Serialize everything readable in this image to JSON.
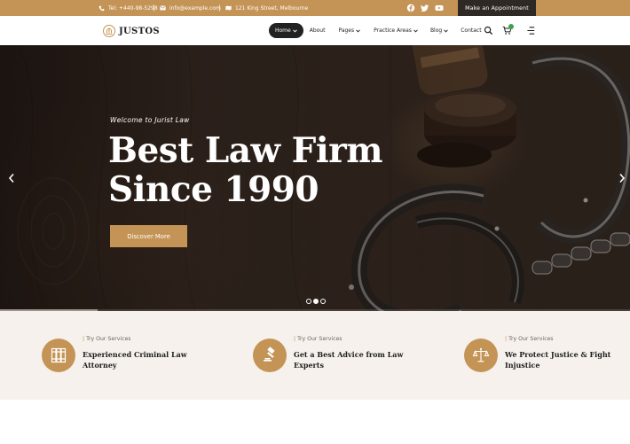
{
  "topbar": {
    "phone": "Tel: +440-98-5298",
    "email": "info@example.com",
    "address": "121 King Street, Melbourne",
    "social": [
      "facebook-icon",
      "twitter-icon",
      "youtube-icon"
    ],
    "cta_label": "Make an Appointment"
  },
  "header": {
    "logo_text": "JUSTOS",
    "nav": [
      {
        "label": "Home",
        "dropdown": true,
        "active": true
      },
      {
        "label": "About",
        "dropdown": false,
        "active": false
      },
      {
        "label": "Pages",
        "dropdown": true,
        "active": false
      },
      {
        "label": "Practice Areas",
        "dropdown": true,
        "active": false
      },
      {
        "label": "Blog",
        "dropdown": true,
        "active": false
      },
      {
        "label": "Contact",
        "dropdown": false,
        "active": false
      }
    ],
    "icons": [
      "search-icon",
      "cart-icon",
      "menu-icon"
    ]
  },
  "hero": {
    "subtitle": "Welcome to Jurist Law",
    "title_line1": "Best Law Firm",
    "title_line2": "Since 1990",
    "button_label": "Discover More",
    "slide_count": 3,
    "active_slide": 2,
    "progress": 0.155
  },
  "services": [
    {
      "tag": "Try Our Services",
      "title": "Experienced Criminal Law Attorney",
      "icon": "law-books-icon"
    },
    {
      "tag": "Try Our Services",
      "title": "Get a Best Advice from Law Experts",
      "icon": "gavel-icon"
    },
    {
      "tag": "Try Our Services",
      "title": "We Protect Justice & Fight Injustice",
      "icon": "scales-icon"
    }
  ],
  "colors": {
    "accent": "#c49456",
    "dark": "#2f2925",
    "services_bg": "#f6f1ec"
  }
}
